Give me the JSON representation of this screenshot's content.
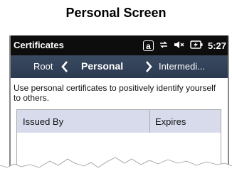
{
  "caption": "Personal Screen",
  "statusbar": {
    "title": "Certificates",
    "indicator_a": "a",
    "time": "5:27"
  },
  "nav": {
    "root_label": "Root",
    "current_label": "Personal",
    "next_label": "Intermedi..."
  },
  "content": {
    "description": "Use personal certificates to positively identify yourself to others."
  },
  "table": {
    "columns": [
      "Issued By",
      "Expires"
    ]
  }
}
